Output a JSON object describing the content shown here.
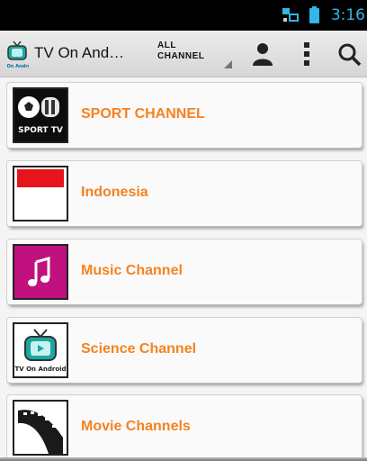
{
  "status_bar": {
    "time": "3:16",
    "icons": [
      "network-icon",
      "signal-icon"
    ]
  },
  "action_bar": {
    "app_title": "TV On Android",
    "logo_text": "TV On Android",
    "category_spinner": {
      "selected": "ALL CHANNEL"
    },
    "buttons": [
      "profile-icon",
      "overflow-menu-icon",
      "search-icon"
    ]
  },
  "channels": [
    {
      "label": "SPORT CHANNEL",
      "thumb_text": "SPORT TV",
      "icon": "sport-tv-thumbnail"
    },
    {
      "label": "Indonesia",
      "icon": "indonesia-flag-thumbnail"
    },
    {
      "label": "Music Channel",
      "icon": "music-note-thumbnail"
    },
    {
      "label": "Science Channel",
      "thumb_text": "TV On Android",
      "icon": "tv-on-android-thumbnail"
    },
    {
      "label": "Movie Channels",
      "icon": "film-reel-thumbnail"
    }
  ],
  "colors": {
    "accent": "#f58220",
    "clock": "#33b5e5",
    "music_bg": "#c0117f",
    "flag_red": "#e8141c"
  }
}
